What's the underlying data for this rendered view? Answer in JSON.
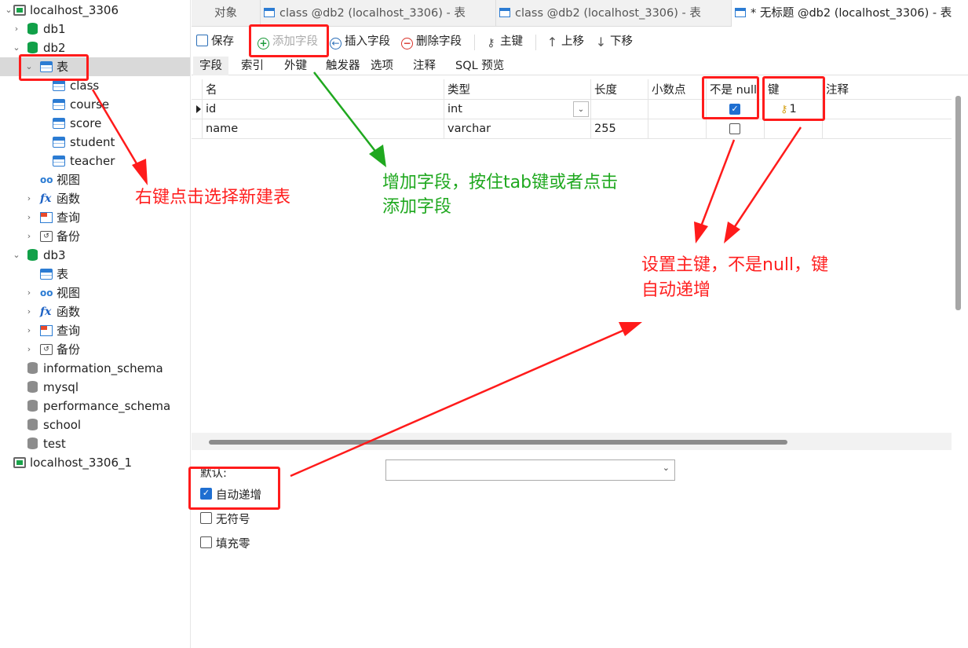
{
  "sidebar": {
    "connection": "localhost_3306",
    "db1": "db1",
    "db2": "db2",
    "db2_tables_folder": "表",
    "tables": [
      "class",
      "course",
      "score",
      "student",
      "teacher"
    ],
    "db2_views": "视图",
    "db2_functions": "函数",
    "db2_queries": "查询",
    "db2_backups": "备份",
    "db3": "db3",
    "db3_tables_folder": "表",
    "db3_views": "视图",
    "db3_functions": "函数",
    "db3_queries": "查询",
    "db3_backups": "备份",
    "other_dbs": [
      "information_schema",
      "mysql",
      "performance_schema",
      "school",
      "test"
    ],
    "connection2": "localhost_3306_1"
  },
  "tabs": [
    {
      "label": "对象"
    },
    {
      "label": "class @db2 (localhost_3306) - 表"
    },
    {
      "label": "class @db2 (localhost_3306) - 表"
    },
    {
      "label": "* 无标题 @db2 (localhost_3306) - 表"
    }
  ],
  "toolbar": {
    "save": "保存",
    "add_field": "添加字段",
    "insert_field": "插入字段",
    "delete_field": "删除字段",
    "primary_key": "主键",
    "move_up": "上移",
    "move_down": "下移"
  },
  "subtabs": [
    "字段",
    "索引",
    "外键",
    "触发器",
    "选项",
    "注释",
    "SQL 预览"
  ],
  "grid": {
    "columns": [
      "名",
      "类型",
      "长度",
      "小数点",
      "不是 null",
      "键",
      "注释"
    ],
    "rows": [
      {
        "name": "id",
        "type": "int",
        "length": "",
        "decimals": "",
        "not_null": true,
        "key": "1",
        "comment": ""
      },
      {
        "name": "name",
        "type": "varchar",
        "length": "255",
        "decimals": "",
        "not_null": false,
        "key": "",
        "comment": ""
      }
    ]
  },
  "properties": {
    "default_label": "默认:",
    "default_value": "",
    "auto_increment": "自动递增",
    "auto_increment_checked": true,
    "unsigned": "无符号",
    "unsigned_checked": false,
    "zerofill": "填充零",
    "zerofill_checked": false
  },
  "annotations": {
    "right_click_note": "右键点击选择新建表",
    "add_field_note_line1": "增加字段，按住tab键或者点击",
    "add_field_note_line2": "添加字段",
    "pk_note_line1": "设置主键，不是null，键",
    "pk_note_line2": "自动递增",
    "red_color": "#ff1b1b",
    "green_color": "#1fa81f"
  }
}
